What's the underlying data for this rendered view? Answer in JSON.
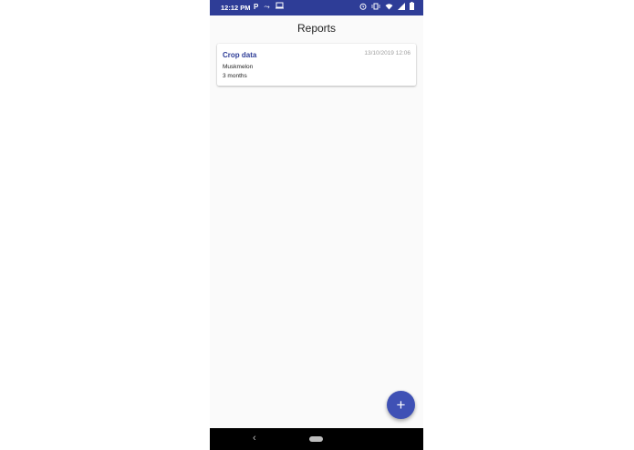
{
  "status_bar": {
    "time": "12:12 PM",
    "left_icons": [
      "parking-icon",
      "cast-icon",
      "laptop-icon"
    ],
    "right_icons": [
      "alarm-icon",
      "vibrate-icon",
      "wifi-icon",
      "signal-icon",
      "battery-icon"
    ]
  },
  "screen": {
    "title": "Reports"
  },
  "reports": [
    {
      "title": "Crop data",
      "date": "13/10/2019 12:06",
      "crop": "Muskmelon",
      "duration": "3 months"
    }
  ],
  "fab": {
    "label": "+"
  },
  "colors": {
    "primary": "#2e3d97",
    "accent": "#3f51b5",
    "background": "#fafafa"
  }
}
